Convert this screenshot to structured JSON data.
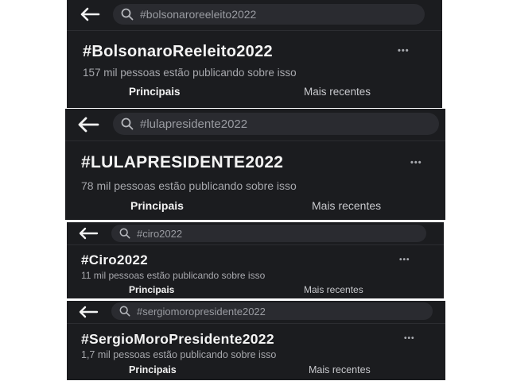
{
  "panels": [
    {
      "search_text": "#bolsonaroreeleito2022",
      "title": "#BolsonaroReeleito2022",
      "subtitle": "157 mil pessoas estão publicando sobre isso",
      "more_label": "•••",
      "tabs": [
        "Principais",
        "Mais recentes"
      ]
    },
    {
      "search_text": "#lulapresidente2022",
      "title": "#LULAPRESIDENTE2022",
      "subtitle": "78 mil pessoas estão publicando sobre isso",
      "more_label": "•••",
      "tabs": [
        "Principais",
        "Mais recentes"
      ]
    },
    {
      "search_text": "#ciro2022",
      "title": "#Ciro2022",
      "subtitle": "11 mil pessoas estão publicando sobre isso",
      "more_label": "•••",
      "tabs": [
        "Principais",
        "Mais recentes"
      ]
    },
    {
      "search_text": "#sergiomoropresidente2022",
      "title": "#SergioMoroPresidente2022",
      "subtitle": "1,7 mil pessoas estão publicando sobre isso",
      "more_label": "•••",
      "tabs": [
        "Principais",
        "Mais recentes"
      ]
    }
  ],
  "icons": {
    "back": "arrow-left-icon",
    "search": "search-icon"
  },
  "colors": {
    "background": "#1b1c1f",
    "search_bg": "#2a2b30",
    "text": "#f4f4f4",
    "muted": "#a7a8ad"
  }
}
